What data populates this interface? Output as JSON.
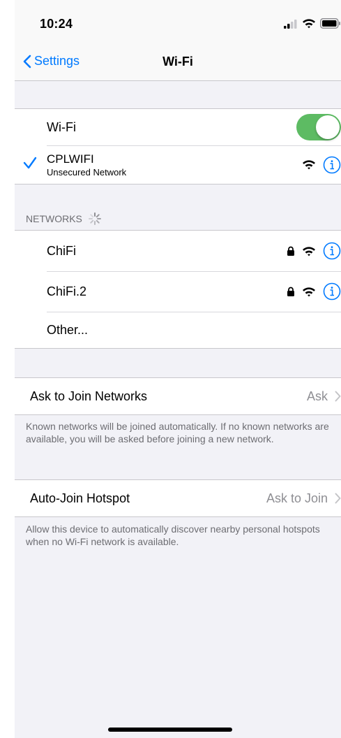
{
  "status_bar": {
    "time": "10:24",
    "icons": [
      "signal-icon",
      "wifi-icon",
      "battery-icon"
    ]
  },
  "navbar": {
    "back_label": "Settings",
    "title": "Wi-Fi"
  },
  "wifi_group": {
    "toggle_label": "Wi-Fi",
    "toggle_on": true,
    "connected": {
      "name": "CPLWIFI",
      "subtitle": "Unsecured Network"
    }
  },
  "networks": {
    "header": "NETWORKS",
    "items": [
      {
        "name": "ChiFi",
        "locked": true
      },
      {
        "name": "ChiFi.2",
        "locked": true
      }
    ],
    "other_label": "Other..."
  },
  "ask_to_join": {
    "label": "Ask to Join Networks",
    "value": "Ask",
    "footer": "Known networks will be joined automatically. If no known networks are available, you will be asked before joining a new network."
  },
  "auto_join_hotspot": {
    "label": "Auto-Join Hotspot",
    "value": "Ask to Join",
    "footer": "Allow this device to automatically discover nearby personal hotspots when no Wi-Fi network is available."
  },
  "colors": {
    "accent": "#007aff",
    "toggle_on": "#5dbb63",
    "background": "#f2f2f7",
    "secondary_text": "#6d6d72"
  }
}
